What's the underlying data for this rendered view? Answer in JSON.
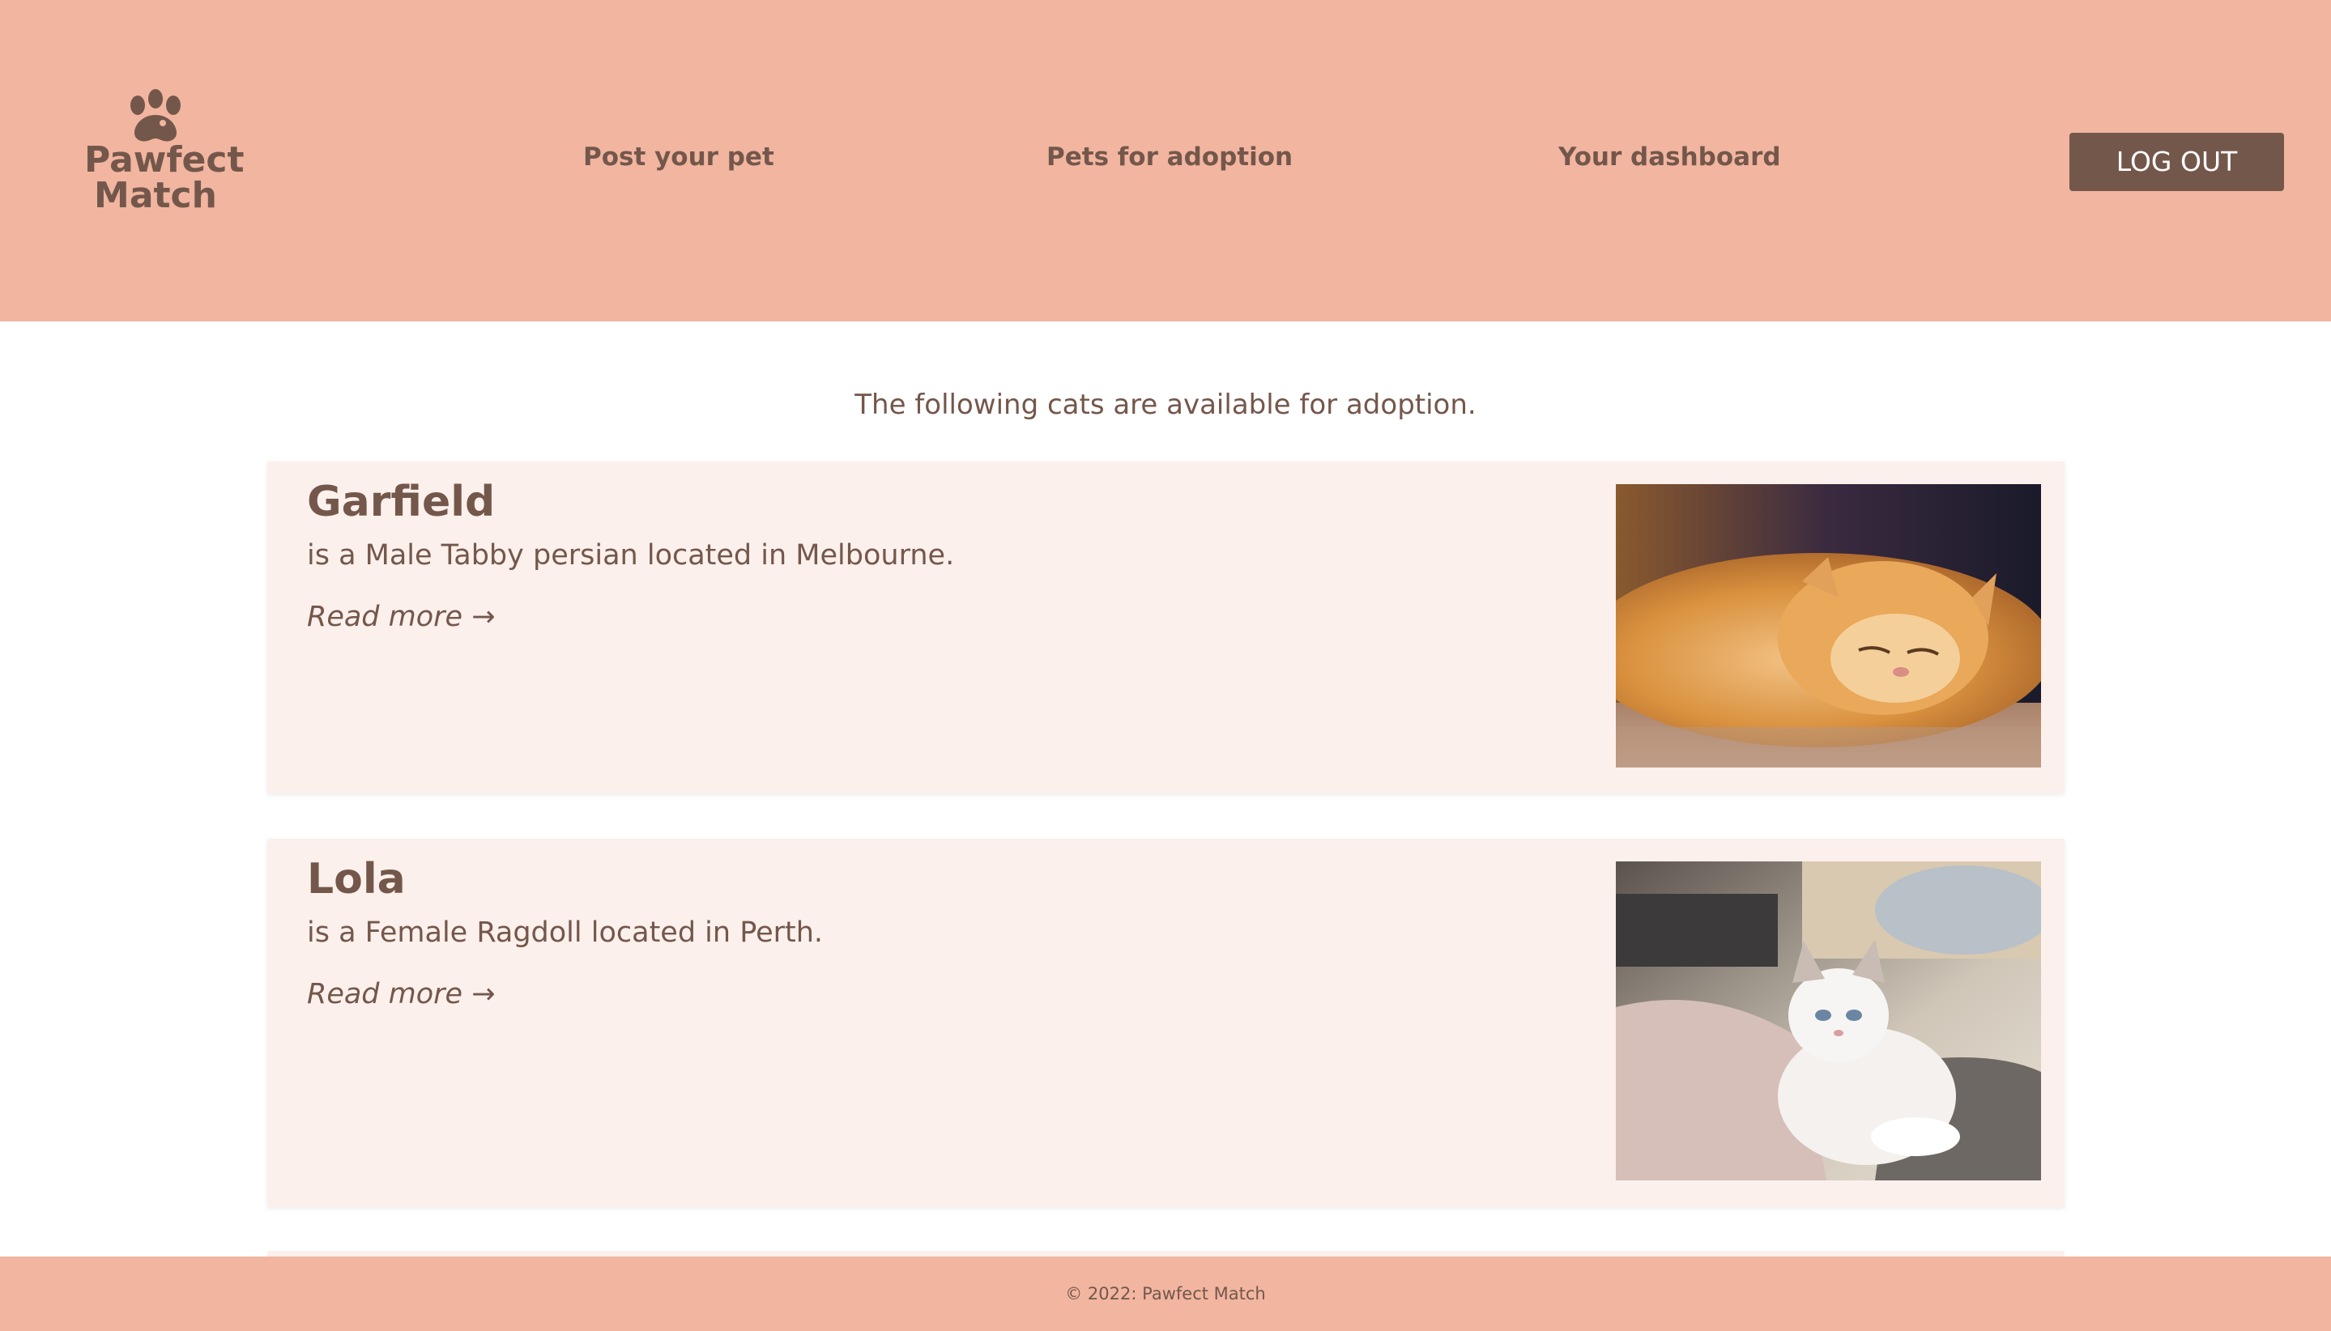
{
  "header": {
    "logo_text_line1": "Pawfect",
    "logo_text_line2": "Match",
    "nav": [
      {
        "label": "Post your pet"
      },
      {
        "label": "Pets for adoption"
      },
      {
        "label": "Your dashboard"
      }
    ],
    "logout_label": "LOG OUT"
  },
  "main": {
    "intro": "The following cats are available for adoption.",
    "cats": [
      {
        "name": "Garfield",
        "description": "is a Male Tabby persian located in Melbourne.",
        "read_more": "Read more →"
      },
      {
        "name": "Lola",
        "description": "is a Female Ragdoll located in Perth.",
        "read_more": "Read more →"
      }
    ]
  },
  "footer": {
    "text": "© 2022: Pawfect Match"
  },
  "colors": {
    "header_bg": "#f1b5a0",
    "text_brown": "#74574b",
    "card_bg": "#fbf0ec",
    "button_bg": "#74574b"
  }
}
